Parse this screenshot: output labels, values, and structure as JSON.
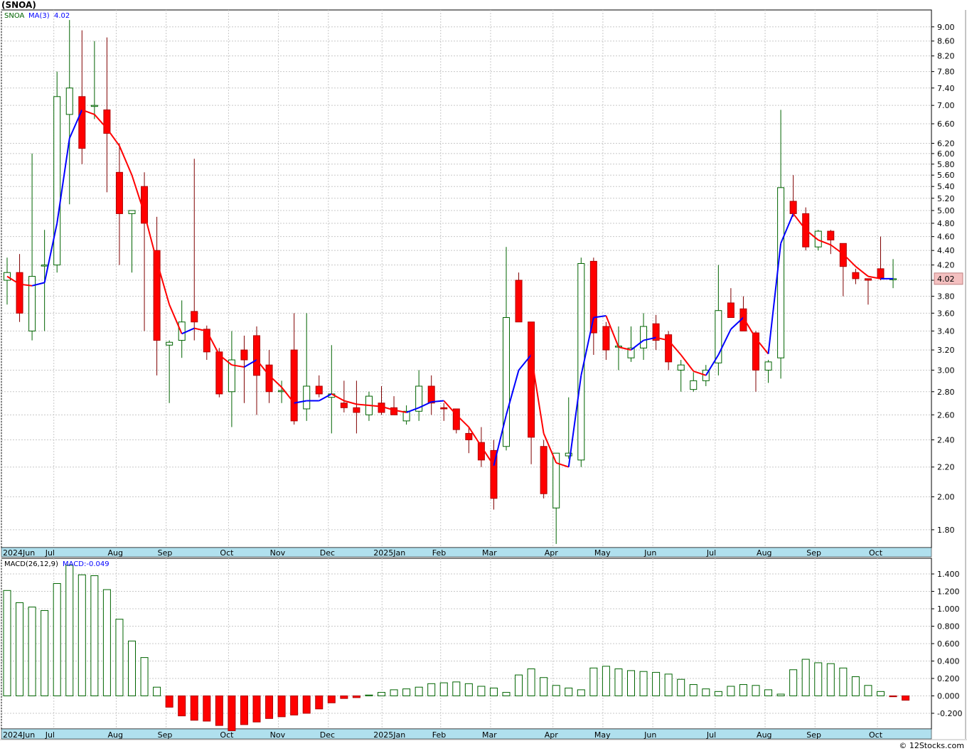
{
  "title": "(SNOA)",
  "credit": "© 12Stocks.com",
  "colors": {
    "up": "#006400",
    "down": "#ff0000",
    "ma_up": "#0000ff",
    "ma_down": "#ff0000",
    "grid": "#c8c8c8",
    "axis_band": "#b0e0ee",
    "frame": "#000000",
    "price_tag_bg": "#f4c0c0"
  },
  "chart_data": [
    {
      "type": "candlestick",
      "scale": "log",
      "legend": {
        "symbol": "SNOA",
        "ma_label": "MA(3)",
        "ma_value": "4.02"
      },
      "last_price_tag": "4.02",
      "ylim": [
        1.7,
        9.5
      ],
      "y_ticks": [
        "9.00",
        "8.60",
        "8.20",
        "7.80",
        "7.40",
        "7.00",
        "6.60",
        "6.20",
        "6.00",
        "5.80",
        "5.60",
        "5.40",
        "5.20",
        "5.00",
        "4.80",
        "4.60",
        "4.40",
        "4.20",
        "4.00",
        "3.80",
        "3.60",
        "3.40",
        "3.20",
        "3.00",
        "2.80",
        "2.60",
        "2.40",
        "2.20",
        "2.00",
        "1.80"
      ],
      "x_ticks": [
        "2024Jun",
        "Jul",
        "Aug",
        "Sep",
        "Oct",
        "Nov",
        "Dec",
        "2025Jan",
        "Feb",
        "Mar",
        "Apr",
        "May",
        "Jun",
        "Jul",
        "Aug",
        "Sep",
        "Oct"
      ],
      "x_tick_index": [
        0,
        4.2,
        9.2,
        13.2,
        18.2,
        22.2,
        26.2,
        30.5,
        35.2,
        39.2,
        44.2,
        48.2,
        52.2,
        57.2,
        61.2,
        65.2,
        70.2
      ],
      "candles": [
        [
          4.0,
          4.3,
          3.7,
          4.1
        ],
        [
          4.1,
          4.35,
          3.5,
          3.6
        ],
        [
          3.4,
          6.0,
          3.3,
          4.05
        ],
        [
          4.2,
          4.7,
          3.4,
          4.2
        ],
        [
          4.2,
          7.8,
          4.1,
          7.2
        ],
        [
          6.8,
          9.2,
          5.1,
          7.4
        ],
        [
          7.2,
          8.9,
          5.8,
          6.1
        ],
        [
          7.0,
          8.6,
          6.7,
          7.0
        ],
        [
          6.9,
          8.7,
          5.3,
          6.4
        ],
        [
          5.65,
          6.2,
          4.2,
          4.95
        ],
        [
          4.95,
          5.0,
          4.1,
          5.0
        ],
        [
          5.4,
          5.65,
          3.4,
          4.8
        ],
        [
          4.4,
          4.9,
          2.95,
          3.3
        ],
        [
          3.25,
          3.3,
          2.7,
          3.28
        ],
        [
          3.3,
          3.75,
          3.12,
          3.5
        ],
        [
          3.62,
          5.9,
          3.3,
          3.5
        ],
        [
          3.42,
          3.46,
          3.1,
          3.18
        ],
        [
          3.18,
          3.22,
          2.75,
          2.78
        ],
        [
          2.8,
          3.4,
          2.5,
          3.1
        ],
        [
          3.2,
          3.35,
          2.7,
          3.1
        ],
        [
          3.35,
          3.45,
          2.6,
          2.95
        ],
        [
          3.05,
          3.2,
          2.7,
          2.8
        ],
        [
          2.8,
          2.9,
          2.7,
          2.81
        ],
        [
          3.2,
          3.6,
          2.52,
          2.55
        ],
        [
          2.65,
          3.6,
          2.55,
          2.85
        ],
        [
          2.85,
          2.95,
          2.75,
          2.78
        ],
        [
          2.75,
          3.25,
          2.45,
          2.78
        ],
        [
          2.7,
          2.9,
          2.62,
          2.66
        ],
        [
          2.66,
          2.9,
          2.45,
          2.62
        ],
        [
          2.6,
          2.8,
          2.55,
          2.76
        ],
        [
          2.7,
          2.85,
          2.6,
          2.62
        ],
        [
          2.66,
          2.76,
          2.6,
          2.6
        ],
        [
          2.55,
          2.68,
          2.52,
          2.63
        ],
        [
          2.63,
          3.0,
          2.55,
          2.85
        ],
        [
          2.85,
          2.95,
          2.6,
          2.7
        ],
        [
          2.66,
          2.7,
          2.55,
          2.65
        ],
        [
          2.65,
          2.65,
          2.45,
          2.48
        ],
        [
          2.45,
          2.5,
          2.3,
          2.4
        ],
        [
          2.38,
          2.5,
          2.2,
          2.25
        ],
        [
          2.32,
          2.4,
          1.92,
          1.99
        ],
        [
          2.35,
          4.45,
          2.32,
          3.55
        ],
        [
          4.0,
          4.1,
          3.5,
          3.5
        ],
        [
          3.5,
          3.5,
          2.22,
          2.42
        ],
        [
          2.35,
          2.4,
          1.99,
          2.02
        ],
        [
          1.93,
          2.3,
          1.72,
          2.3
        ],
        [
          2.28,
          2.75,
          2.26,
          2.3
        ],
        [
          2.25,
          4.3,
          2.2,
          4.22
        ],
        [
          4.25,
          4.3,
          3.15,
          3.38
        ],
        [
          3.45,
          3.5,
          3.1,
          3.2
        ],
        [
          3.23,
          3.45,
          3.0,
          3.24
        ],
        [
          3.12,
          3.45,
          3.08,
          3.22
        ],
        [
          3.22,
          3.6,
          3.1,
          3.45
        ],
        [
          3.48,
          3.58,
          3.2,
          3.3
        ],
        [
          3.36,
          3.4,
          3.0,
          3.08
        ],
        [
          3.0,
          3.1,
          2.8,
          3.05
        ],
        [
          2.82,
          2.98,
          2.8,
          2.9
        ],
        [
          2.9,
          3.05,
          2.85,
          3.0
        ],
        [
          3.07,
          4.2,
          2.95,
          3.63
        ],
        [
          3.72,
          3.9,
          3.65,
          3.55
        ],
        [
          3.65,
          3.8,
          3.4,
          3.4
        ],
        [
          3.38,
          3.4,
          2.8,
          3.0
        ],
        [
          3.0,
          3.1,
          2.88,
          3.08
        ],
        [
          3.12,
          6.9,
          2.92,
          5.38
        ],
        [
          5.15,
          5.6,
          4.9,
          4.95
        ],
        [
          4.95,
          5.05,
          4.4,
          4.45
        ],
        [
          4.45,
          4.7,
          4.4,
          4.68
        ],
        [
          4.68,
          4.7,
          4.35,
          4.55
        ],
        [
          4.5,
          4.5,
          3.8,
          4.18
        ],
        [
          4.1,
          4.15,
          3.95,
          4.02
        ],
        [
          4.02,
          4.02,
          3.7,
          4.0
        ],
        [
          4.15,
          4.6,
          4.0,
          4.03
        ],
        [
          4.02,
          4.28,
          3.9,
          4.02
        ]
      ],
      "ma": [
        4.05,
        3.95,
        3.93,
        3.97,
        4.8,
        6.3,
        6.9,
        6.8,
        6.5,
        6.15,
        5.6,
        4.95,
        4.25,
        3.7,
        3.37,
        3.43,
        3.4,
        3.15,
        3.05,
        3.03,
        3.1,
        2.95,
        2.84,
        2.7,
        2.72,
        2.72,
        2.78,
        2.72,
        2.69,
        2.68,
        2.67,
        2.64,
        2.62,
        2.66,
        2.71,
        2.72,
        2.6,
        2.5,
        2.35,
        2.21,
        2.6,
        3.0,
        3.15,
        2.45,
        2.23,
        2.2,
        2.95,
        3.55,
        3.57,
        3.23,
        3.2,
        3.3,
        3.33,
        3.3,
        3.15,
        2.99,
        2.95,
        3.15,
        3.42,
        3.55,
        3.32,
        3.16,
        4.5,
        4.95,
        4.7,
        4.55,
        4.48,
        4.35,
        4.18,
        4.05,
        4.02,
        4.02
      ]
    },
    {
      "type": "bar",
      "legend": {
        "label": "MACD(26,12,9)",
        "value_label": "MACD:-0.049"
      },
      "ylim": [
        -0.38,
        1.58
      ],
      "y_ticks": [
        "1.400",
        "1.200",
        "1.000",
        "0.800",
        "0.600",
        "0.400",
        "0.200",
        "0.000",
        "-0.200"
      ],
      "x_ticks": [
        "2024Jun",
        "Jul",
        "Aug",
        "Sep",
        "Oct",
        "Nov",
        "Dec",
        "2025Jan",
        "Feb",
        "Mar",
        "Apr",
        "May",
        "Jun",
        "Jul",
        "Aug",
        "Sep",
        "Oct"
      ],
      "values": [
        1.21,
        1.07,
        1.02,
        0.98,
        1.29,
        1.5,
        1.39,
        1.38,
        1.22,
        0.88,
        0.63,
        0.44,
        0.1,
        -0.13,
        -0.23,
        -0.28,
        -0.29,
        -0.34,
        -0.4,
        -0.33,
        -0.3,
        -0.26,
        -0.24,
        -0.22,
        -0.2,
        -0.15,
        -0.08,
        -0.03,
        -0.02,
        0.01,
        0.04,
        0.07,
        0.08,
        0.1,
        0.14,
        0.15,
        0.16,
        0.14,
        0.11,
        0.09,
        0.04,
        0.24,
        0.31,
        0.21,
        0.12,
        0.09,
        0.07,
        0.32,
        0.34,
        0.31,
        0.29,
        0.28,
        0.27,
        0.25,
        0.19,
        0.13,
        0.08,
        0.05,
        0.11,
        0.13,
        0.12,
        0.07,
        0.02,
        0.3,
        0.42,
        0.38,
        0.37,
        0.32,
        0.22,
        0.12,
        0.05,
        -0.01,
        -0.05
      ]
    }
  ]
}
